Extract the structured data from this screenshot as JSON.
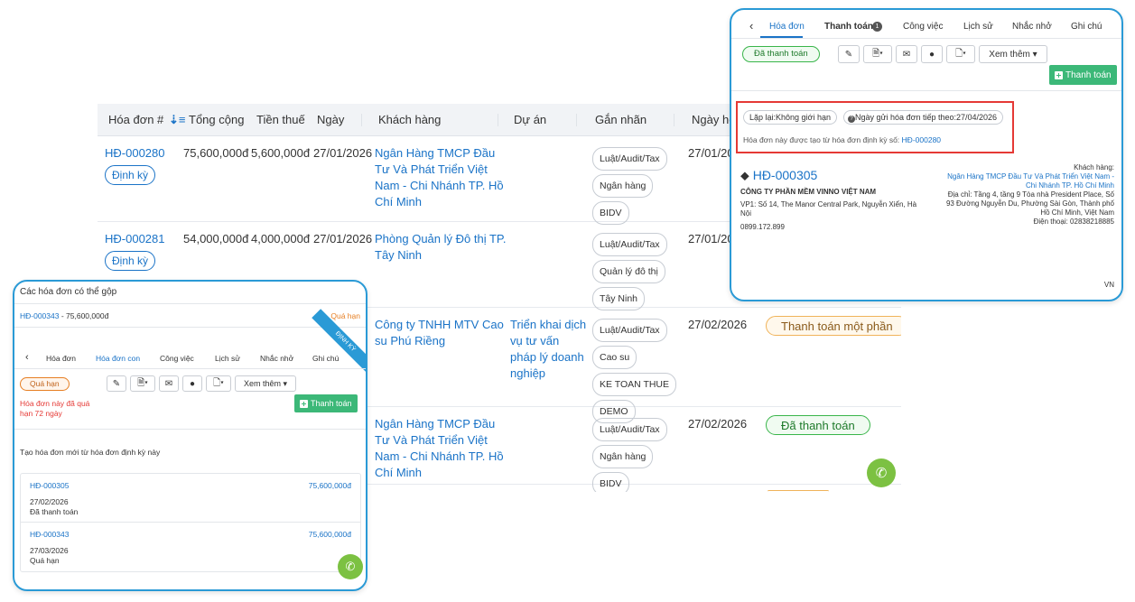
{
  "table": {
    "headers": [
      "Hóa đơn #",
      "Tổng cộng",
      "Tiền thuế",
      "Ngày",
      "Khách hàng",
      "Dự án",
      "Gắn nhãn",
      "Ngày hế"
    ],
    "rows": [
      {
        "invoice": "HĐ-000280",
        "badge": "Định kỳ",
        "total": "75,600,000đ",
        "tax": "5,600,000đ",
        "date": "27/01/2026",
        "customer": "Ngân Hàng TMCP Đầu Tư Và Phát Triển Việt Nam - Chi Nhánh TP. Hồ Chí Minh",
        "project": "",
        "tags": [
          "Luật/Audit/Tax",
          "Ngân hàng",
          "BIDV"
        ],
        "due": "27/01/20",
        "status": ""
      },
      {
        "invoice": "HĐ-000281",
        "badge": "Định kỳ",
        "total": "54,000,000đ",
        "tax": "4,000,000đ",
        "date": "27/01/2026",
        "customer": "Phòng Quản lý Đô thị TP. Tây Ninh",
        "project": "",
        "tags": [
          "Luật/Audit/Tax",
          "Quản lý đô thị",
          "Tây Ninh"
        ],
        "due": "27/01/20",
        "status": ""
      },
      {
        "invoice": "",
        "badge": "",
        "total": "",
        "tax": "",
        "date": "",
        "customer": "Công ty TNHH MTV Cao su Phú Riềng",
        "project": "Triển khai dịch vụ tư vấn pháp lý doanh nghiệp",
        "tags": [
          "Luật/Audit/Tax",
          "Cao su",
          "KE TOAN THUE",
          "DEMO"
        ],
        "due": "27/02/2026",
        "status": "Thanh toán một phần"
      },
      {
        "invoice": "",
        "badge": "",
        "total": "",
        "tax": "",
        "date": "",
        "customer": "Ngân Hàng TMCP Đầu Tư Và Phát Triển Việt Nam - Chi Nhánh TP. Hồ Chí Minh",
        "project": "",
        "tags": [
          "Luật/Audit/Tax",
          "Ngân hàng",
          "BIDV"
        ],
        "due": "27/02/2026",
        "status": "Đã thanh toán"
      }
    ]
  },
  "right_panel": {
    "tabs": [
      "Hóa đơn",
      "Thanh toán",
      "Công việc",
      "Lịch sử",
      "Nhắc nhở",
      "Ghi chú"
    ],
    "payment_badge": "1",
    "status": "Đã thanh toán",
    "more_label": "Xem thêm",
    "pay_button": "Thanh toán",
    "repeat_chip": "Lặp lại:Không giới hạn",
    "next_send_chip": "Ngày gửi hóa đơn tiếp theo:27/04/2026",
    "created_from_prefix": "Hóa đơn này được tạo từ hóa đơn định kỳ số:",
    "created_from_link": "HĐ-000280",
    "invoice_no": "HĐ-000305",
    "company": "CÔNG TY PHẦN MỀM VINNO VIỆT NAM",
    "company_addr": "VP1: Số 14, The Manor Central Park, Nguyễn Xiển, Hà Nội",
    "company_phone": "0899.172.899",
    "customer_label": "Khách hàng:",
    "customer_name": "Ngân Hàng TMCP Đầu Tư Và Phát Triển Việt Nam - Chi Nhánh TP. Hồ Chí Minh",
    "customer_addr": "Địa chỉ: Tầng 4, tầng 9 Tòa nhà President Place, Số 93 Đường Nguyễn Du, Phường Sài Gòn, Thành phố Hồ Chí Minh, Việt Nam",
    "customer_phone": "Điện thoại: 02838218885",
    "country": "VN"
  },
  "left_panel": {
    "title": "Các hóa đơn có thể gộp",
    "merge_item": "HĐ-000343",
    "merge_amount": " - 75,600,000đ",
    "merge_status": "Quá hạn",
    "ribbon": "ĐỊNH KỲ",
    "tabs": [
      "Hóa đơn",
      "Hóa đơn con",
      "Công việc",
      "Lịch sử",
      "Nhắc nhở",
      "Ghi chú"
    ],
    "status": "Quá hạn",
    "more_label": "Xem thêm",
    "pay_button": "Thanh toán",
    "overdue_note": "Hóa đơn này đã quá hạn 72 ngày",
    "section_title": "Tạo hóa đơn mới từ hóa đơn định kỳ này",
    "children": [
      {
        "no": "HĐ-000305",
        "amount": "75,600,000đ",
        "date": "27/02/2026",
        "status": "Đã thanh toán"
      },
      {
        "no": "HĐ-000343",
        "amount": "75,600,000đ",
        "date": "27/03/2026",
        "status": "Quá hạn"
      }
    ]
  },
  "colors": {
    "accent": "#1a73c7",
    "panel_border": "#2a9ad6",
    "green": "#3cb878",
    "danger": "#e53935",
    "overdue": "#e67e22"
  }
}
